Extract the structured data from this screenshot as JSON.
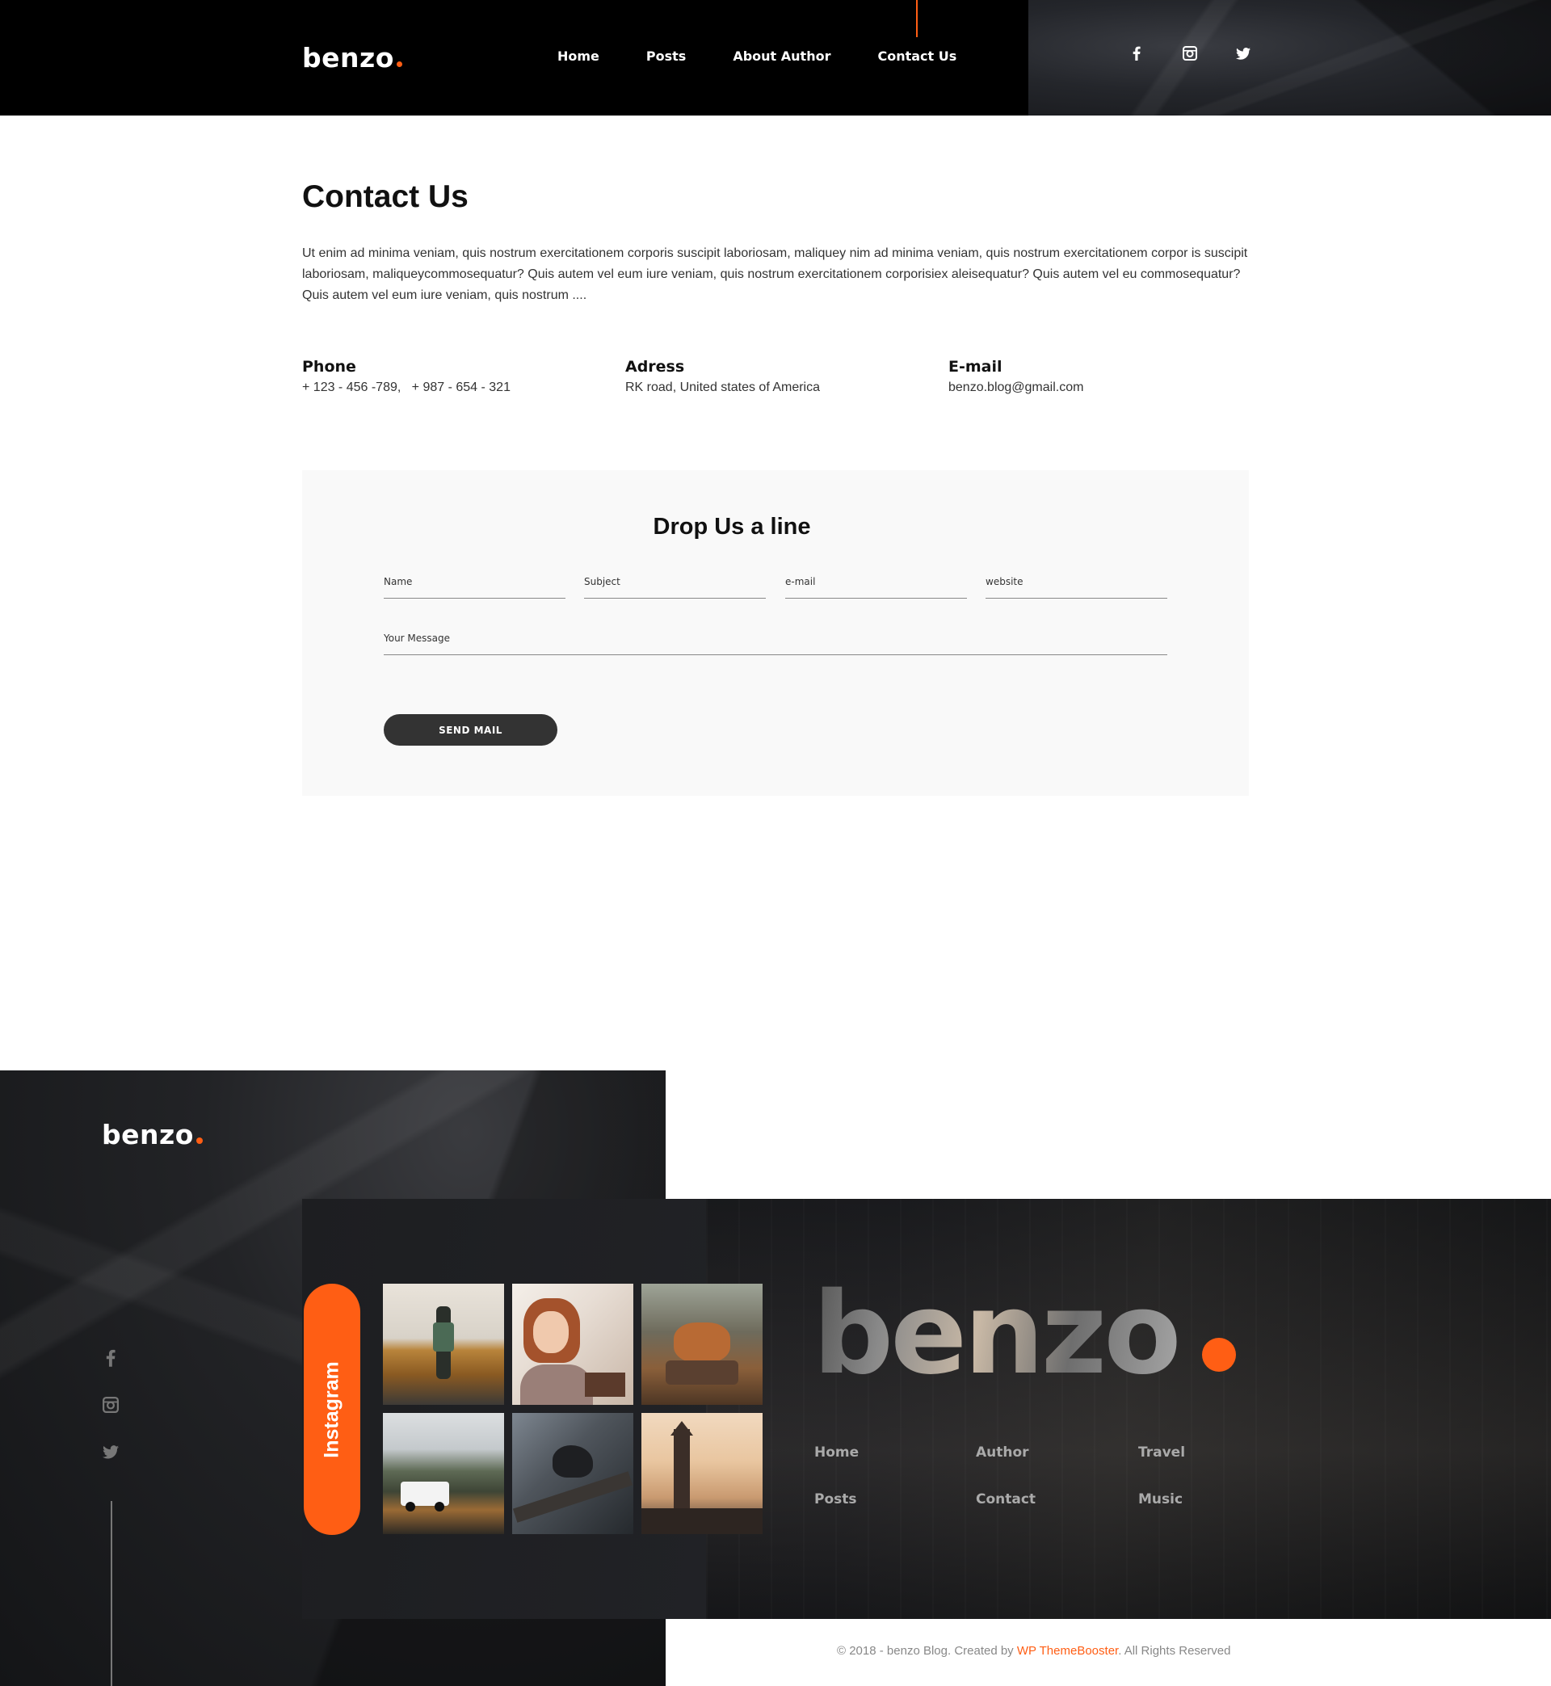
{
  "brand": {
    "name": "benzo",
    "accent": "#ff5e14"
  },
  "nav": {
    "items": [
      {
        "label": "Home"
      },
      {
        "label": "Posts"
      },
      {
        "label": "About Author"
      },
      {
        "label": "Contact Us"
      }
    ],
    "active": "Contact Us"
  },
  "social": [
    "facebook-icon",
    "instagram-icon",
    "twitter-icon"
  ],
  "main": {
    "title": "Contact Us",
    "intro": "Ut enim ad minima veniam, quis nostrum exercitationem corporis suscipit laboriosam, maliquey nim ad minima veniam, quis nostrum exercitationem corpor is suscipit laboriosam, maliqueycommosequatur? Quis autem vel eum iure veniam, quis nostrum exercitationem corporisiex aleisequatur? Quis autem vel eu commosequatur? Quis autem vel eum iure veniam, quis nostrum ....",
    "contacts": [
      {
        "heading": "Phone",
        "value": "+ 123 - 456 -789,   + 987 - 654 - 321"
      },
      {
        "heading": "Adress",
        "value": "RK road, United states of America"
      },
      {
        "heading": "E-mail",
        "value": "benzo.blog@gmail.com"
      }
    ]
  },
  "form": {
    "title": "Drop Us a line",
    "fields": {
      "name": "Name",
      "subject": "Subject",
      "email": "e-mail",
      "website": "website",
      "message": "Your Message"
    },
    "submit_label": "SEND MAIL"
  },
  "footer": {
    "instagram_label": "Instagram",
    "photos": [
      "walking-man-photo",
      "woman-reading-photo",
      "dog-photo",
      "jeep-photo",
      "bird-photo",
      "clock-tower-photo"
    ],
    "links": [
      {
        "label": "Home"
      },
      {
        "label": "Author"
      },
      {
        "label": "Travel"
      },
      {
        "label": "Posts"
      },
      {
        "label": "Contact"
      },
      {
        "label": "Music"
      }
    ],
    "copyright_prefix": "© 2018 - benzo Blog. Created by ",
    "copyright_link": "WP ThemeBooster",
    "copyright_suffix": ". All Rights Reserved"
  }
}
